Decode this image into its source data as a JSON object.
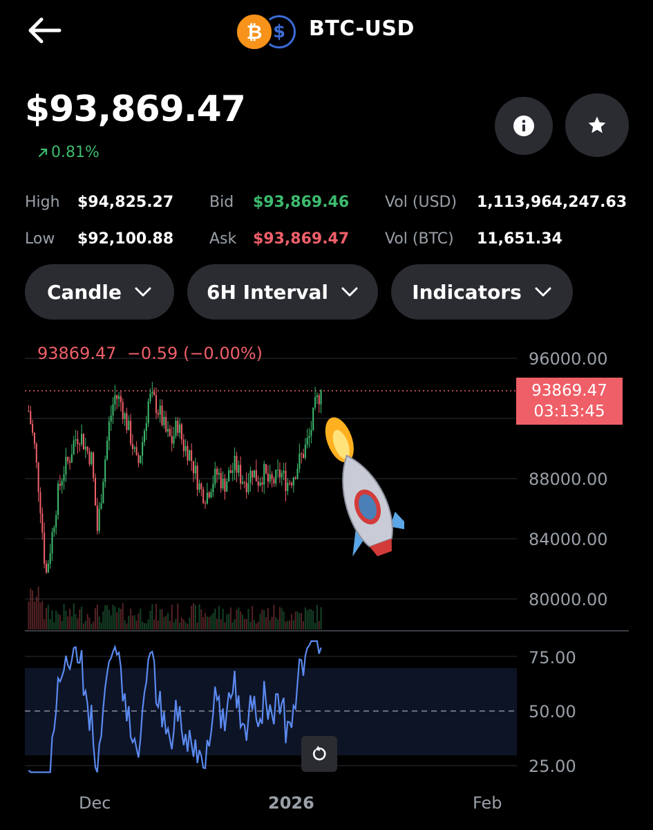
{
  "header": {
    "pair": "BTC-USD",
    "back_icon": "arrow-left-icon",
    "coin_icons": [
      "bitcoin-icon",
      "usd-coin-icon"
    ],
    "btc_glyph": "₿",
    "usd_glyph": "$"
  },
  "price": {
    "current": "$93,869.47",
    "change": "0.81%",
    "change_icon": "arrow-up-right-icon"
  },
  "stats": {
    "high_label": "High",
    "high_value": "$94,825.27",
    "low_label": "Low",
    "low_value": "$92,100.88",
    "bid_label": "Bid",
    "bid_value": "$93,869.46",
    "ask_label": "Ask",
    "ask_value": "$93,869.47",
    "vol_usd_label": "Vol (USD)",
    "vol_usd_value": "1,113,964,247.63",
    "vol_btc_label": "Vol (BTC)",
    "vol_btc_value": "11,651.34"
  },
  "controls": {
    "chart_type": "Candle",
    "interval": "6H Interval",
    "indicators": "Indicators"
  },
  "chart": {
    "ohlc_price": "93869.47",
    "ohlc_change": "−0.59 (−0.00%)",
    "last_price": "93869.47",
    "countdown": "03:13:45",
    "price_ticks": [
      "96000.00",
      "88000.00",
      "84000.00",
      "80000.00"
    ],
    "rsi_ticks": [
      "75.00",
      "50.00",
      "25.00"
    ],
    "time_ticks": [
      "Dec",
      "2026",
      "Feb"
    ],
    "colors": {
      "up": "#3dbb6e",
      "down": "#f0606a",
      "rsi": "#5b8af0"
    }
  },
  "chart_data": {
    "type": "candlestick",
    "price_axis": {
      "ticks": [
        96000,
        88000,
        84000,
        80000
      ],
      "last_price": 93869.47
    },
    "close_series_approx": [
      92500,
      90200,
      86500,
      81500,
      84000,
      86800,
      88500,
      89200,
      90600,
      91000,
      90000,
      89300,
      84500,
      88200,
      91500,
      93500,
      93200,
      91800,
      90500,
      88700,
      90800,
      93400,
      93100,
      92200,
      91000,
      90500,
      91700,
      90200,
      89800,
      88500,
      87200,
      86900,
      87800,
      88400,
      87500,
      88300,
      88900,
      88100,
      87800,
      88600,
      87900,
      88400,
      87600,
      87900,
      88400,
      87700,
      88100,
      89000,
      89800,
      90800,
      92800,
      93869.47
    ],
    "rsi": {
      "ticks": [
        75,
        50,
        25
      ],
      "last_value": 79,
      "midline": 50,
      "band": [
        30,
        70
      ]
    }
  }
}
